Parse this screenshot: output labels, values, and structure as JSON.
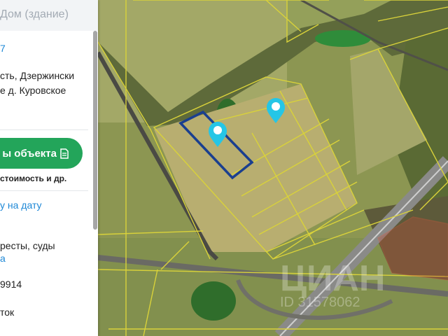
{
  "panel": {
    "title": "Дом (здание)",
    "link_top": "7",
    "address_line1": "сть, Дзержински",
    "address_line2": "е д. Куровское",
    "report_button": "ы объекта",
    "report_caption": "стоимость и др.",
    "date_link": "у на дату",
    "restrictions_text": "ресты, суды",
    "phone_fragment": "9914",
    "owner_text": "ток"
  },
  "map": {
    "watermark": "ЦИАН",
    "watermark_id": "ID 31578062",
    "parcel_color": "#d9d23a",
    "selected_parcel_color": "#1a3f8f",
    "marker_color": "#25c6e6",
    "markers": [
      "location-pin",
      "location-pin"
    ]
  }
}
